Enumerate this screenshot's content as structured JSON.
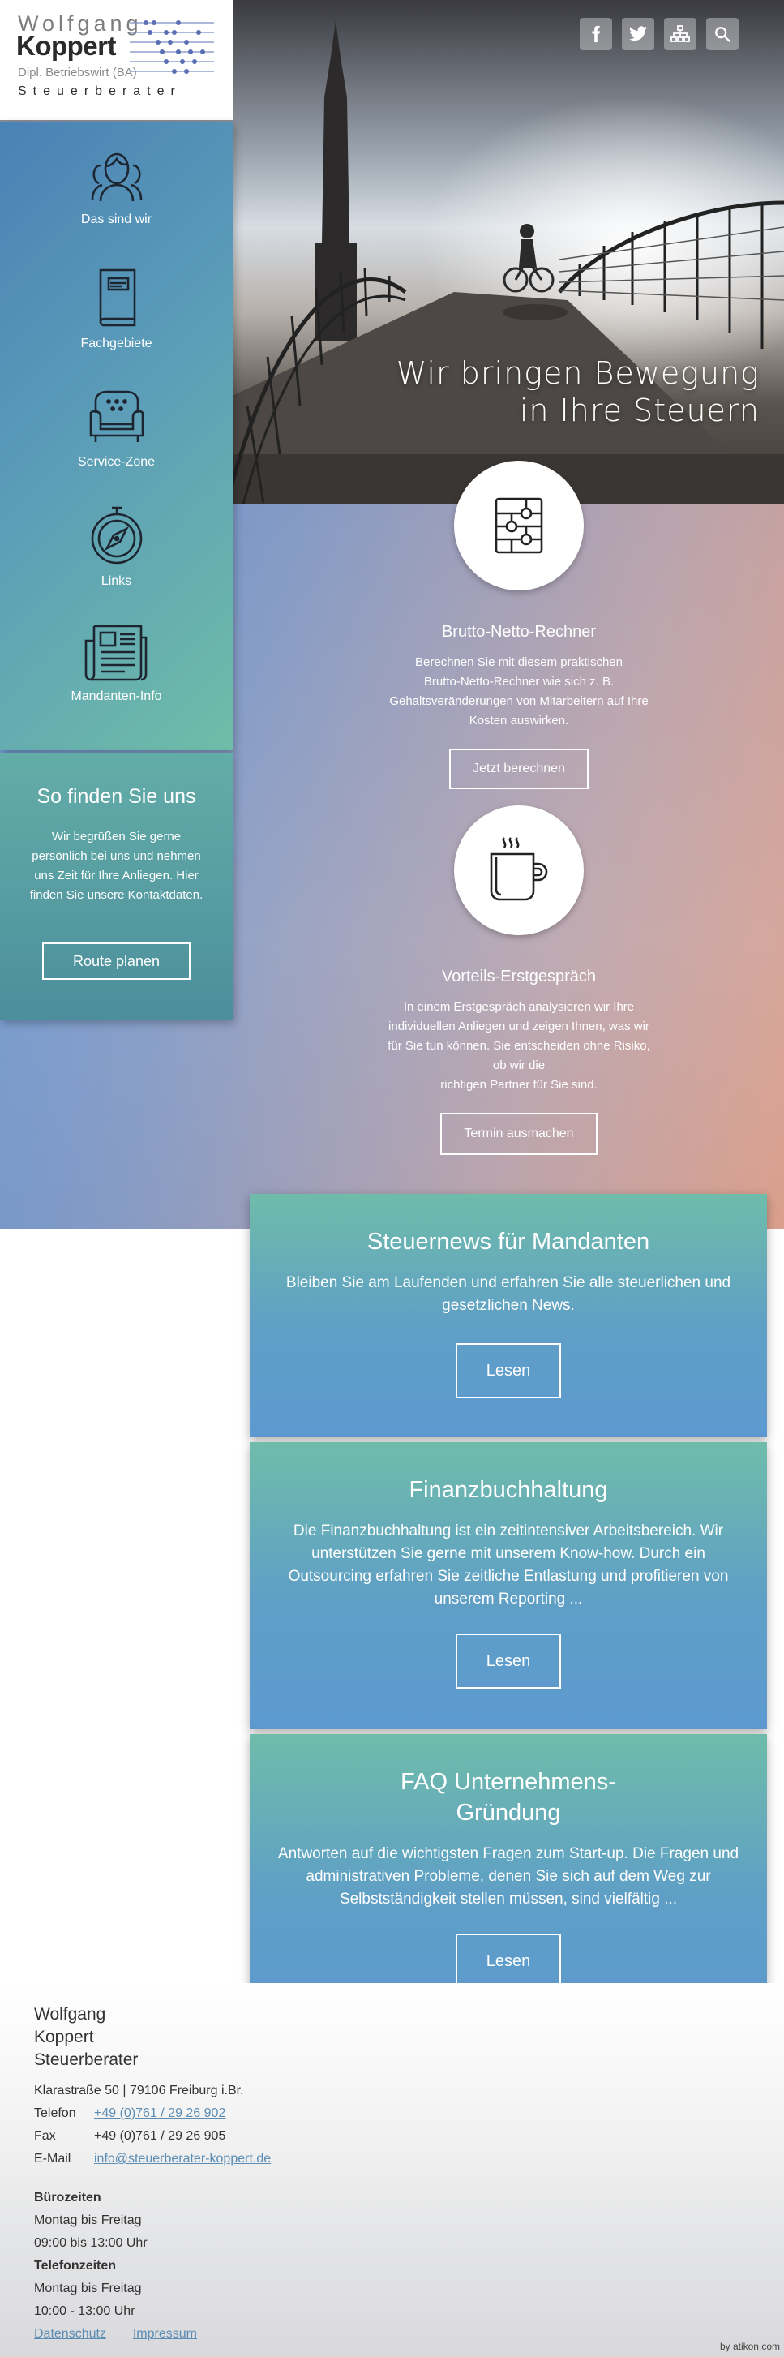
{
  "brand": {
    "first_name": "Wolfgang",
    "last_name": "Koppert",
    "subtitle": "Dipl. Betriebswirt (BA)",
    "profession": "Steuerberater"
  },
  "header_icons": [
    "facebook-icon",
    "twitter-icon",
    "sitemap-icon",
    "search-icon"
  ],
  "hero": {
    "line1": "Wir bringen Bewegung",
    "line2": "in Ihre Steuern"
  },
  "nav": [
    {
      "label": "Das sind wir",
      "icon": "team-icon"
    },
    {
      "label": "Fachgebiete",
      "icon": "book-icon"
    },
    {
      "label": "Service-Zone",
      "icon": "armchair-icon"
    },
    {
      "label": "Links",
      "icon": "compass-icon"
    },
    {
      "label": "Mandanten-Info",
      "icon": "newspaper-icon"
    }
  ],
  "find_us": {
    "title": "So finden Sie uns",
    "text": "Wir begrüßen Sie gerne persönlich bei uns und nehmen uns Zeit für Ihre Anliegen. Hier finden Sie unsere Kontaktdaten.",
    "button": "Route planen"
  },
  "features": [
    {
      "title": "Brutto-Netto-Rechner",
      "text_lines": [
        "Berechnen Sie mit diesem praktischen",
        "Brutto-Netto-Rechner wie sich z. B.",
        "Gehaltsveränderungen von Mitarbeitern auf Ihre",
        "Kosten auswirken."
      ],
      "button": "Jetzt berechnen",
      "icon": "calculator-sliders-icon"
    },
    {
      "title": "Vorteils-Erstgespräch",
      "text_lines": [
        "In einem Erstgespräch analysieren wir Ihre",
        "individuellen Anliegen und zeigen Ihnen, was wir",
        "für Sie tun können. Sie entscheiden ohne Risiko,",
        "ob wir die",
        "richtigen Partner für Sie sind."
      ],
      "button": "Termin ausmachen",
      "icon": "coffee-cup-icon"
    }
  ],
  "cards": [
    {
      "title": "Steuernews für Mandanten",
      "text": "Bleiben Sie am Laufenden und erfahren Sie alle steuerlichen und gesetzlichen News.",
      "button": "Lesen"
    },
    {
      "title": "Finanzbuchhaltung",
      "text": "Die Finanzbuchhaltung ist ein zeitintensiver Arbeitsbereich. Wir unterstützen Sie gerne mit unserem Know-how. Durch ein Outsourcing erfahren Sie zeitliche Entlastung und profitieren von unserem Reporting ...",
      "button": "Lesen"
    },
    {
      "title_line1": "FAQ Unternehmens-",
      "title_line2": "Gründung",
      "text": "Antworten auf die wichtigsten Fragen zum Start-up. Die Fragen und administrativen Probleme, denen Sie sich auf dem Weg zur Selbstständigkeit stellen müssen, sind vielfältig ...",
      "button": "Lesen"
    }
  ],
  "footer": {
    "name_line1": "Wolfgang",
    "name_line2": "Koppert",
    "name_line3": "Steuerberater",
    "address": "Klarastraße 50 | 79106 Freiburg i.Br.",
    "phone_label": "Telefon",
    "phone": "+49 (0)761 / 29 26 902",
    "fax_label": "Fax",
    "fax": "+49 (0)761 / 29 26 905",
    "email_label": "E-Mail",
    "email": "info@steuerberater-koppert.de",
    "office_hours_title": "Bürozeiten",
    "office_days": "Montag bis Freitag",
    "office_times": "09:00 bis 13:00 Uhr",
    "phone_hours_title": "Telefonzeiten",
    "phone_days": "Montag bis Freitag",
    "phone_times": "10:00 - 13:00 Uhr",
    "privacy": "Datenschutz",
    "imprint": "Impressum",
    "credit": "by atikon.com"
  }
}
